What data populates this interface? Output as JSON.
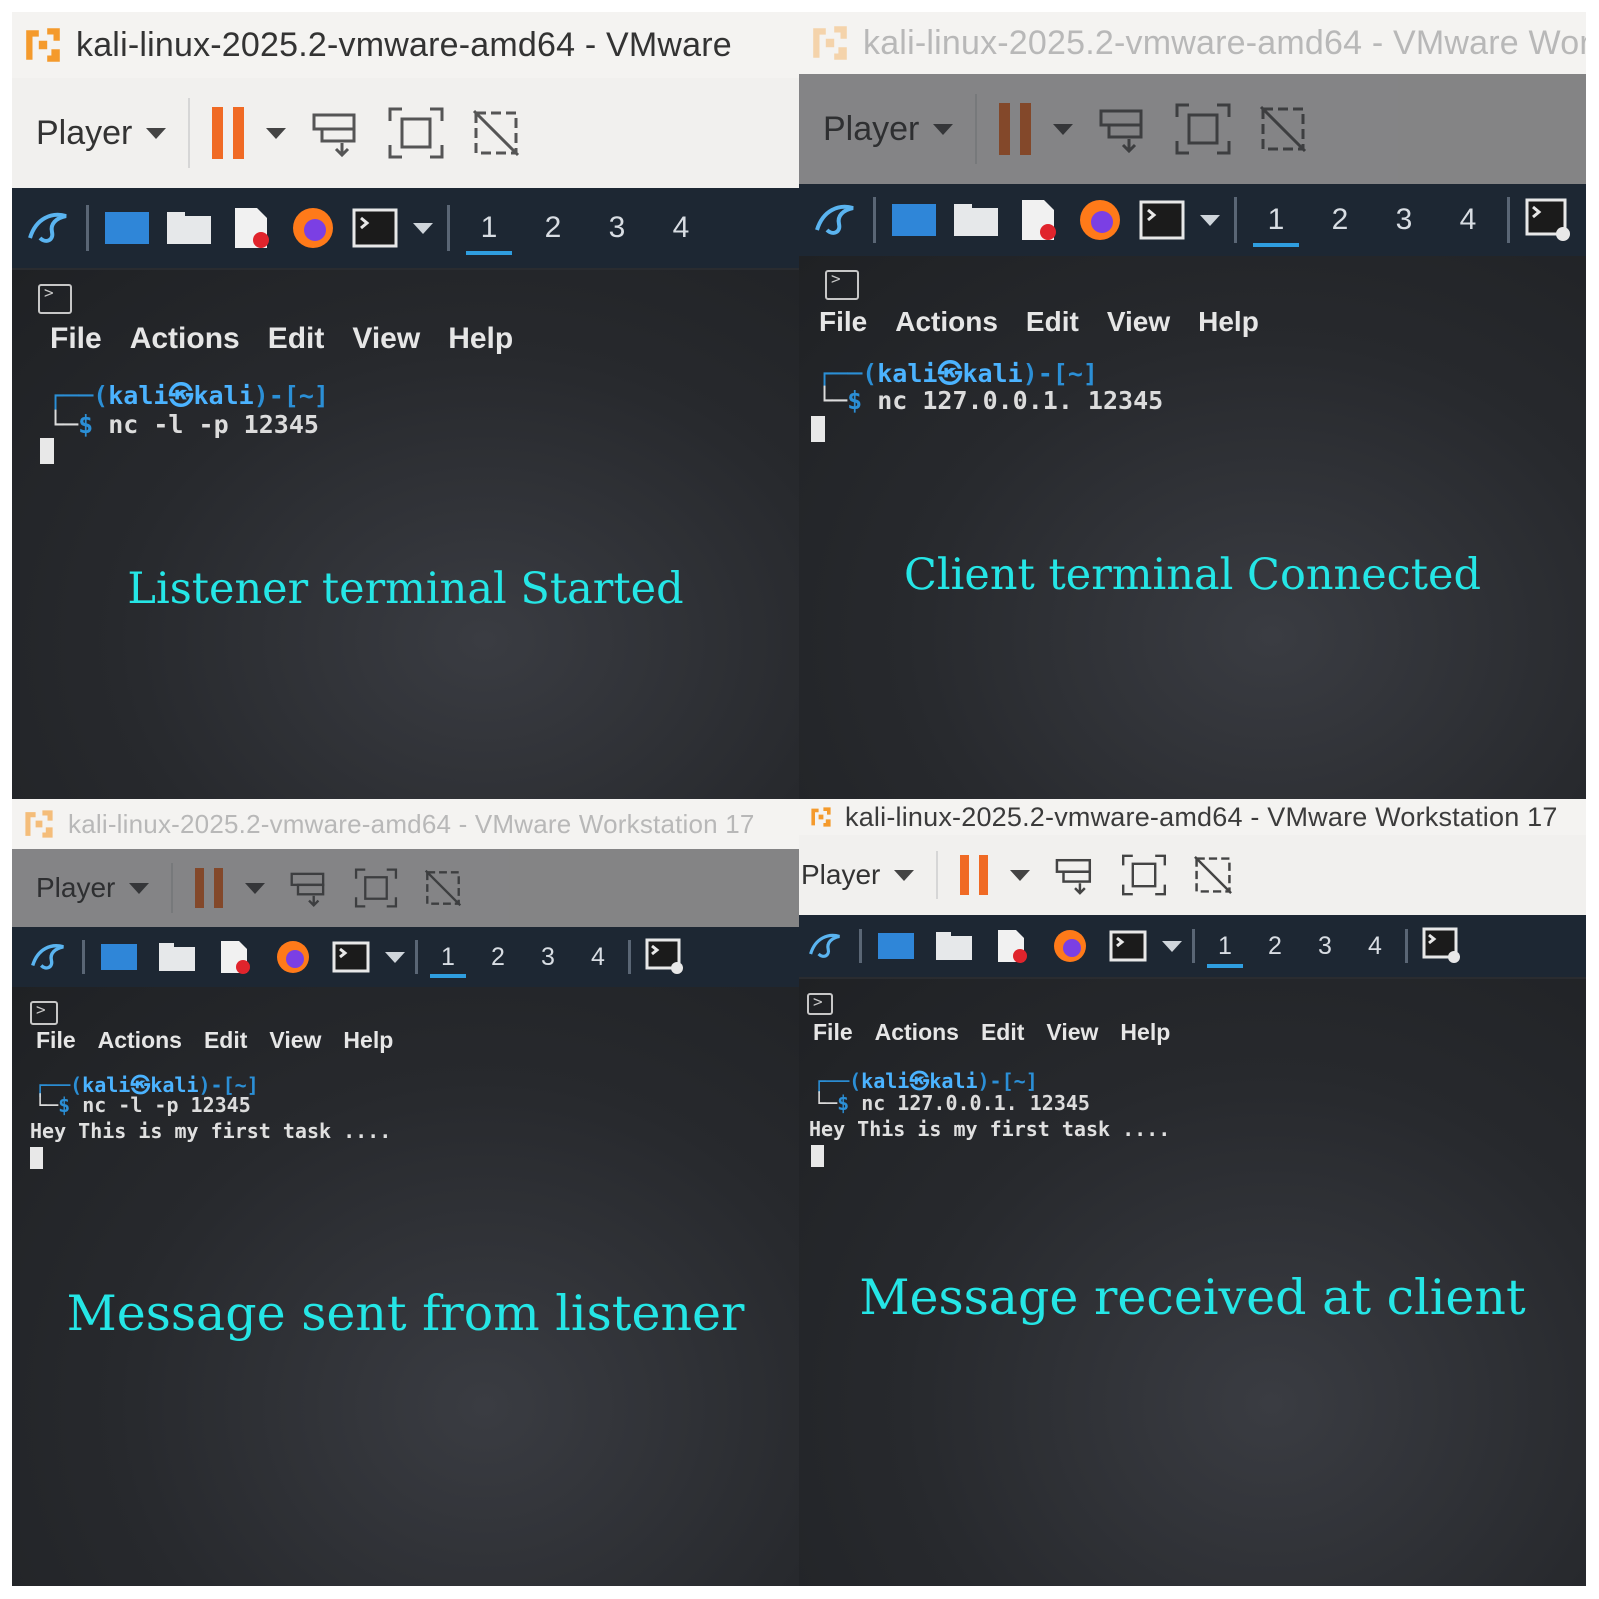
{
  "window_title_short": "kali-linux-2025.2-vmware-amd64 - VMware",
  "window_title_p2": "kali-linux-2025.2-vmware-amd64 - VMware Works",
  "window_title_full": "kali-linux-2025.2-vmware-amd64 - VMware Workstation 17",
  "toolbar": {
    "player_label": "Player"
  },
  "workspaces": [
    "1",
    "2",
    "3",
    "4"
  ],
  "menu": [
    "File",
    "Actions",
    "Edit",
    "View",
    "Help"
  ],
  "prompt": {
    "user": "kali",
    "at": "㉿",
    "host": "kali",
    "dir": "~"
  },
  "commands": {
    "listener": "nc -l -p 12345",
    "client": "nc 127.0.0.1. 12345"
  },
  "message": "Hey This is my first task ....",
  "captions": {
    "p1": "Listener terminal Started",
    "p2": "Client terminal Connected",
    "p3": "Message sent from listener",
    "p4": "Message received at client"
  },
  "colors": {
    "accent": "#f06a24",
    "caption": "#25e6e6",
    "prompt": "#2b8fd6",
    "panelbar": "#1d2733"
  }
}
